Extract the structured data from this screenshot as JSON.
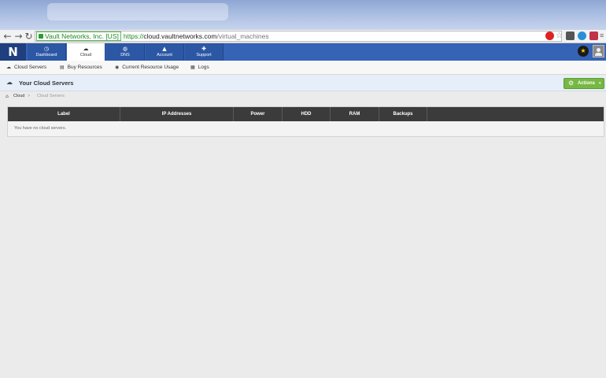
{
  "browser": {
    "ev_label": "Vault Networks, Inc. [US]",
    "url_proto": "https://",
    "url_host": "cloud.vaultnetworks.com",
    "url_path": "/virtual_machines"
  },
  "nav": {
    "logo": "N",
    "tabs": [
      {
        "label": "Dashboard",
        "icon": "◷"
      },
      {
        "label": "Cloud",
        "icon": "☁"
      },
      {
        "label": "DNS",
        "icon": "◍"
      },
      {
        "label": "Account",
        "icon": "▲"
      },
      {
        "label": "Support",
        "icon": "✚"
      }
    ],
    "star_icon": "★"
  },
  "subnav": {
    "items": [
      {
        "label": "Cloud Servers",
        "icon": "☁"
      },
      {
        "label": "Buy Resources",
        "icon": "▤"
      },
      {
        "label": "Current Resource Usage",
        "icon": "◉"
      },
      {
        "label": "Logs",
        "icon": "▦"
      }
    ]
  },
  "page": {
    "cloud_icon": "☁",
    "title": "Your Cloud Servers",
    "actions": {
      "gear": "⚙",
      "label": "Actions",
      "caret": "▾"
    }
  },
  "breadcrumb": {
    "home_icon": "⌂",
    "items": [
      "Cloud",
      "Cloud Servers"
    ],
    "sep": ">"
  },
  "table": {
    "columns": [
      "Label",
      "IP Addresses",
      "Power",
      "HDD",
      "RAM",
      "Backups"
    ],
    "empty_message": "You have no cloud servers."
  },
  "colors": {
    "nav_blue": "#3563b6",
    "actions_green": "#76b843",
    "table_header": "#3b3b3b"
  }
}
